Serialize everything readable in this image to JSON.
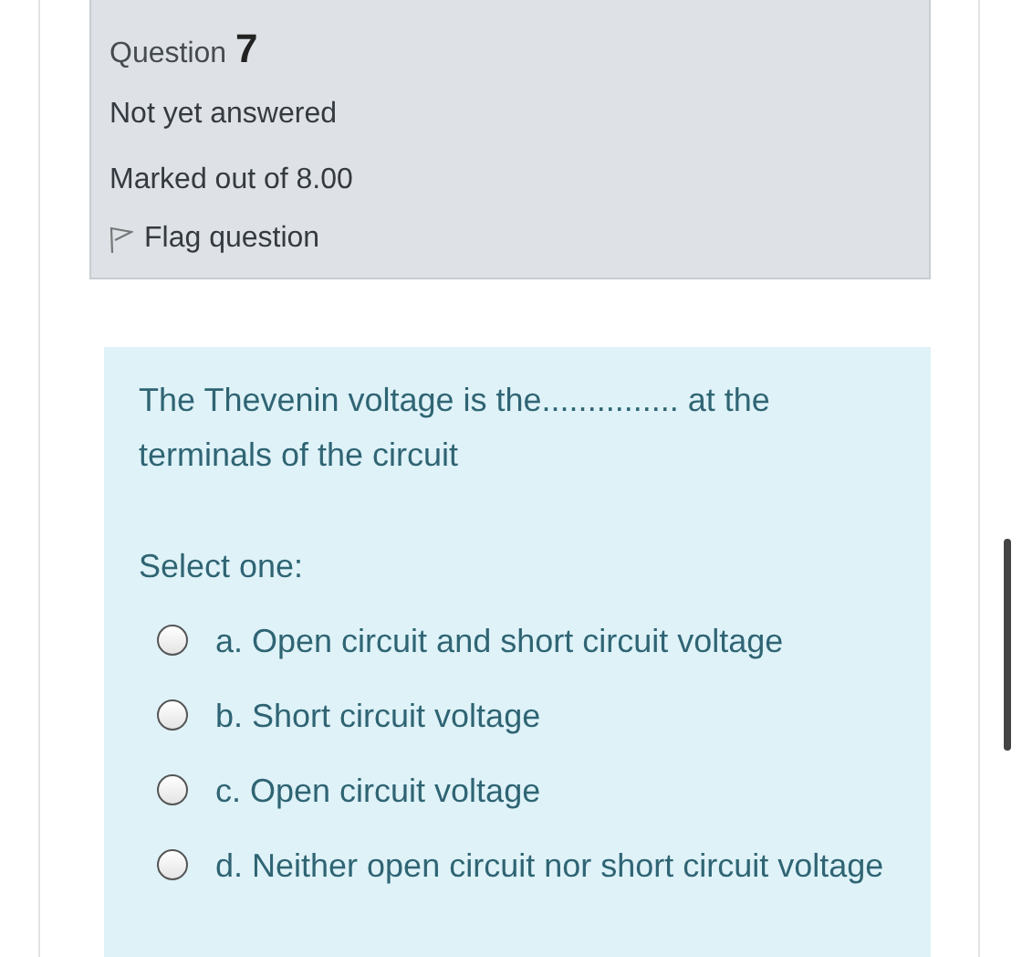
{
  "info": {
    "question_label": "Question",
    "question_number": "7",
    "status": "Not yet answered",
    "marks": "Marked out of 8.00",
    "flag": {
      "label": "Flag question",
      "flagged": false
    }
  },
  "content": {
    "question_text": "The Thevenin voltage is the............... at the terminals of the circuit",
    "prompt": "Select one:",
    "options": [
      {
        "label": "a. Open circuit and short circuit voltage",
        "selected": false
      },
      {
        "label": "b. Short circuit voltage",
        "selected": false
      },
      {
        "label": "c. Open circuit voltage",
        "selected": false
      },
      {
        "label": "d. Neither open circuit nor short circuit voltage",
        "selected": false
      }
    ]
  }
}
